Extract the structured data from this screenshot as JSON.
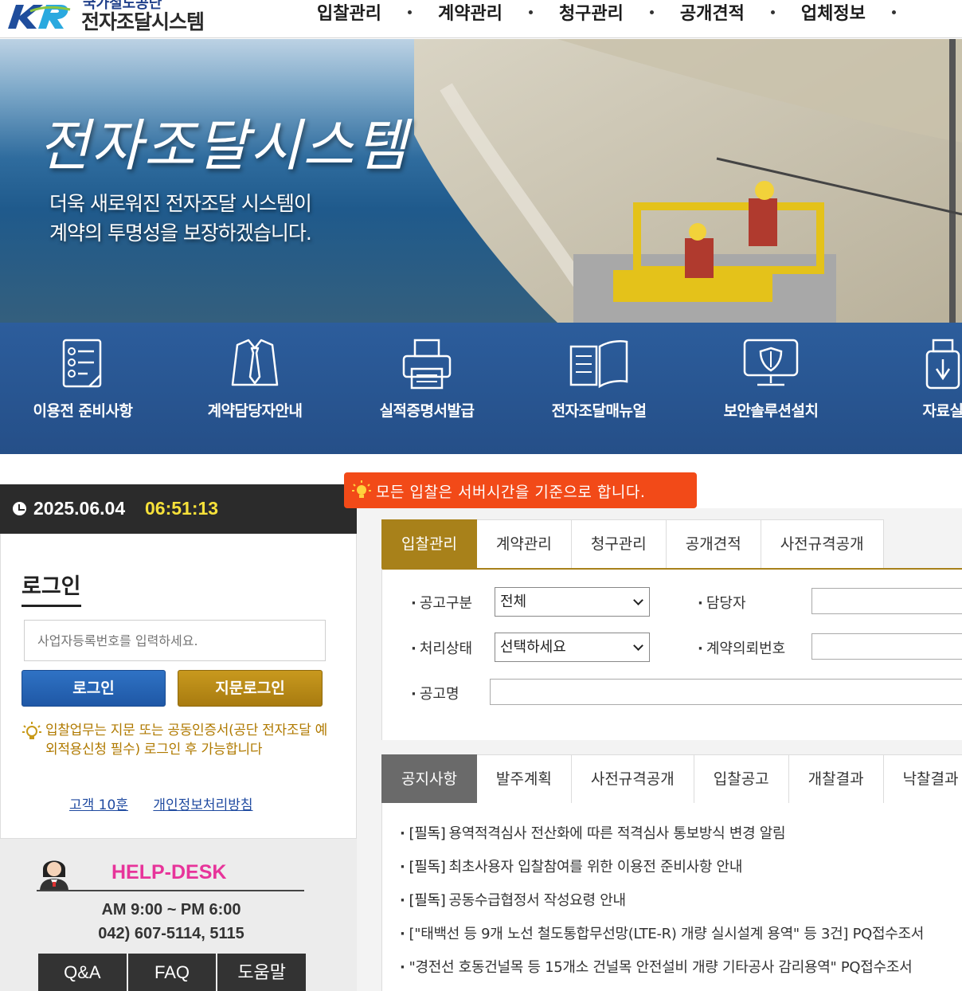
{
  "header": {
    "logo_sub": "국가철도공단",
    "logo_title": "전자조달시스템",
    "nav": [
      "입찰관리",
      "계약관리",
      "청구관리",
      "공개견적",
      "업체정보"
    ]
  },
  "hero": {
    "title": "전자조달시스템",
    "desc_line1": "더욱 새로워진 전자조달 시스템이",
    "desc_line2": "계약의 투명성을 보장하겠습니다."
  },
  "quick_menu": [
    {
      "label": "이용전 준비사항",
      "icon": "checklist-icon"
    },
    {
      "label": "계약담당자안내",
      "icon": "shirt-tie-icon"
    },
    {
      "label": "실적증명서발급",
      "icon": "printer-icon"
    },
    {
      "label": "전자조달매뉴얼",
      "icon": "book-icon"
    },
    {
      "label": "보안솔루션설치",
      "icon": "monitor-shield-icon"
    },
    {
      "label": "자료실",
      "icon": "usb-icon"
    }
  ],
  "clock": {
    "date": "2025.06.04",
    "time": "06:51:13"
  },
  "server_notice": "모든 입찰은 서버시간을 기준으로 합니다.",
  "login": {
    "title": "로그인",
    "placeholder": "사업자등록번호를 입력하세요.",
    "login_button": "로그인",
    "finger_button": "지문로그인",
    "note": "입찰업무는 지문 또는 공동인증서(공단 전자조달 예외적용신청 필수) 로그인 후 가능합니다",
    "links": [
      "고객 10훈",
      "개인정보처리방침"
    ]
  },
  "helpdesk": {
    "title": "HELP-DESK",
    "hours": "AM 9:00 ~ PM 6:00",
    "phone": "042) 607-5114, 5115",
    "buttons": [
      "Q&A",
      "FAQ",
      "도움말"
    ]
  },
  "search": {
    "tabs": [
      "입찰관리",
      "계약관리",
      "청구관리",
      "공개견적",
      "사전규격공개"
    ],
    "fields": {
      "notice_type_label": "공고구분",
      "notice_type_value": "전체",
      "manager_label": "담당자",
      "status_label": "처리상태",
      "status_value": "선택하세요",
      "contract_req_label": "계약의뢰번호",
      "title_label": "공고명"
    }
  },
  "notice": {
    "tabs": [
      "공지사항",
      "발주계획",
      "사전규격공개",
      "입찰공고",
      "개찰결과",
      "낙찰결과"
    ],
    "items": [
      {
        "tag": "[필독]",
        "text": "용역적격심사 전산화에 따른 적격심사 통보방식 변경 알림"
      },
      {
        "tag": "[필독]",
        "text": "최초사용자 입찰참여를 위한 이용전 준비사항 안내"
      },
      {
        "tag": "[필독]",
        "text": "공동수급협정서 작성요령 안내"
      },
      {
        "tag": "",
        "text": "[\"태백선 등 9개 노선 철도통합무선망(LTE-R) 개량 실시설계 용역\" 등 3건] PQ접수조서"
      },
      {
        "tag": "",
        "text": "\"경전선 호동건널목 등 15개소 건널목 안전설비 개량 기타공사 감리용역\" PQ접수조서"
      }
    ]
  }
}
